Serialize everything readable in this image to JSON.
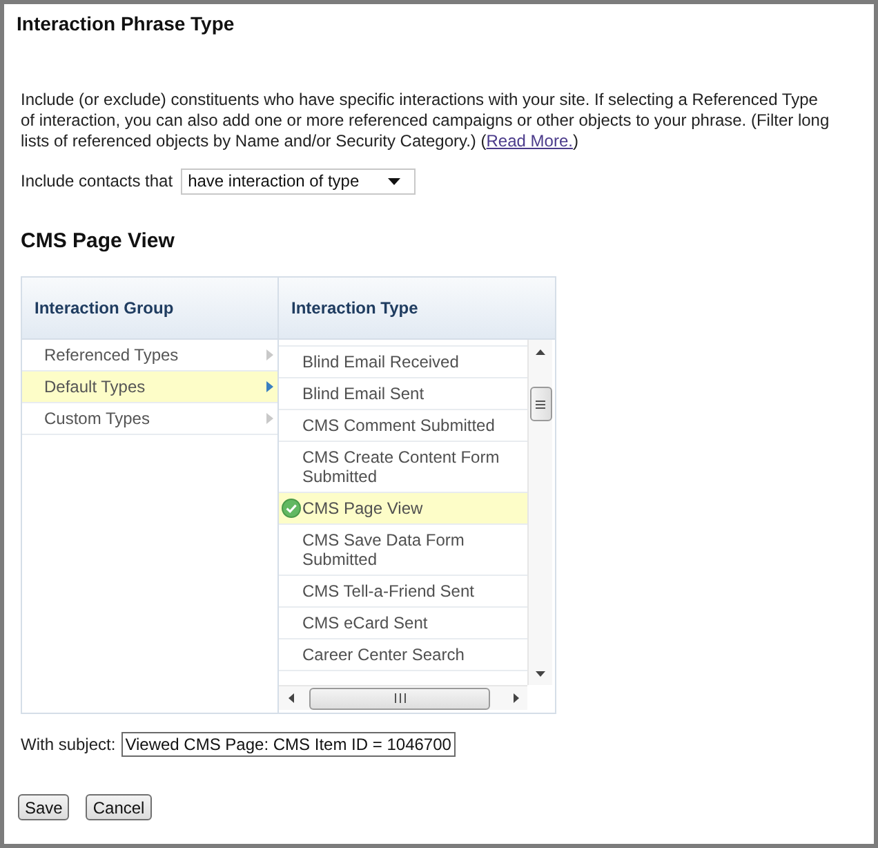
{
  "window": {
    "title": "Interaction Phrase Type"
  },
  "description": {
    "text": "Include (or exclude) constituents who have specific interactions with your site. If selecting a Referenced Type of interaction, you can also add one or more referenced campaigns or other objects to your phrase. (Filter long lists of referenced objects by Name and/or Security Category.) (",
    "link": "Read More.",
    "text_after": ")"
  },
  "filter": {
    "label": "Include contacts that",
    "value": "have interaction of type"
  },
  "section": {
    "title": "CMS Page View"
  },
  "picker": {
    "columns": [
      "Interaction Group",
      "Interaction Type"
    ],
    "groups": [
      {
        "label": "Referenced Types",
        "selected": false
      },
      {
        "label": "Default Types",
        "selected": true
      },
      {
        "label": "Custom Types",
        "selected": false
      }
    ],
    "types": [
      {
        "label": "Blind Email Received",
        "selected": false
      },
      {
        "label": "Blind Email Sent",
        "selected": false
      },
      {
        "label": "CMS Comment Submitted",
        "selected": false
      },
      {
        "label": "CMS Create Content Form Submitted",
        "selected": false
      },
      {
        "label": "CMS Page View",
        "selected": true
      },
      {
        "label": "CMS Save Data Form Submitted",
        "selected": false
      },
      {
        "label": "CMS Tell-a-Friend Sent",
        "selected": false
      },
      {
        "label": "CMS eCard Sent",
        "selected": false
      },
      {
        "label": "Career Center Search",
        "selected": false
      }
    ]
  },
  "subject": {
    "label": "With subject:",
    "value": "Viewed CMS Page: CMS Item ID = 1046700"
  },
  "buttons": [
    "Save",
    "Cancel"
  ]
}
